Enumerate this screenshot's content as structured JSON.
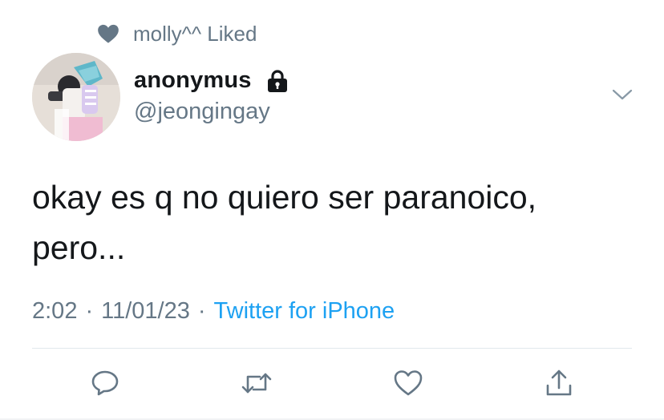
{
  "social_context": {
    "text": "molly^^ Liked",
    "icon": "heart-filled-icon"
  },
  "author": {
    "display_name": "anonymus",
    "handle": "@jeongingay",
    "protected_icon": "lock-icon",
    "avatar": "avatar-image"
  },
  "tweet": {
    "text": "okay es q no quiero ser paranoico,\npero...",
    "time": "2:02",
    "date": "11/01/23",
    "separator": "·",
    "source": "Twitter for iPhone"
  },
  "actions": [
    "reply-icon",
    "retweet-icon",
    "like-icon",
    "share-icon"
  ],
  "colors": {
    "text_primary": "#14171a",
    "text_secondary": "#657786",
    "link": "#1da1f2",
    "divider": "#e1e8ed"
  }
}
